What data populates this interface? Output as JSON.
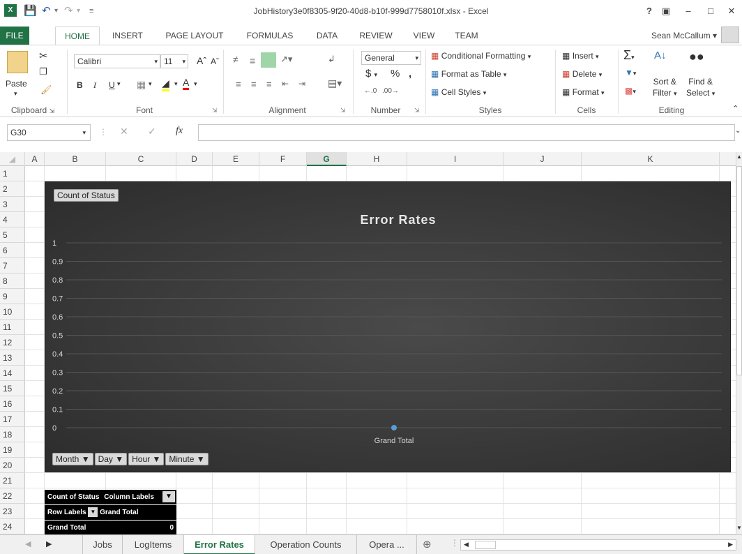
{
  "titlebar": {
    "title": "JobHistory3e0f8305-9f20-40d8-b10f-999d7758010f.xlsx - Excel",
    "help": "?",
    "user": "Sean McCallum"
  },
  "ribbon_tabs": [
    "FILE",
    "HOME",
    "INSERT",
    "PAGE LAYOUT",
    "FORMULAS",
    "DATA",
    "REVIEW",
    "VIEW",
    "TEAM"
  ],
  "clipboard": {
    "paste": "Paste",
    "label": "Clipboard"
  },
  "font": {
    "name": "Calibri",
    "size": "11",
    "label": "Font",
    "bold": "B",
    "italic": "I",
    "underline": "U"
  },
  "alignment": {
    "label": "Alignment"
  },
  "number": {
    "format": "General",
    "currency": "$",
    "percent": "%",
    "comma": ",",
    "label": "Number"
  },
  "styles": {
    "conditional": "Conditional Formatting",
    "table": "Format as Table",
    "cell": "Cell Styles",
    "label": "Styles"
  },
  "cells": {
    "insert": "Insert",
    "delete": "Delete",
    "format": "Format",
    "label": "Cells"
  },
  "editing": {
    "sort_line1": "Sort &",
    "sort_line2": "Filter",
    "find_line1": "Find &",
    "find_line2": "Select",
    "label": "Editing"
  },
  "formula_bar": {
    "name_box": "G30",
    "fx": "fx",
    "value": ""
  },
  "columns": [
    "A",
    "B",
    "C",
    "D",
    "E",
    "F",
    "G",
    "H",
    "I",
    "J",
    "K"
  ],
  "selected_column": "G",
  "rows": [
    "1",
    "2",
    "3",
    "4",
    "5",
    "6",
    "7",
    "8",
    "9",
    "10",
    "11",
    "12",
    "13",
    "14",
    "15",
    "16",
    "17",
    "18",
    "19",
    "20",
    "21",
    "22",
    "23",
    "24"
  ],
  "chart_data": {
    "type": "line",
    "title": "Error Rates",
    "value_field_button": "Count of Status",
    "categories": [
      "Grand Total"
    ],
    "series": [
      {
        "values": [
          0
        ],
        "color": "#5b9bd5"
      }
    ],
    "ylim": [
      0,
      1
    ],
    "yticks": [
      "0",
      "0.1",
      "0.2",
      "0.3",
      "0.4",
      "0.5",
      "0.6",
      "0.7",
      "0.8",
      "0.9",
      "1"
    ],
    "grid": true,
    "axis_field_buttons": [
      "Month",
      "Day",
      "Hour",
      "Minute"
    ]
  },
  "pivot": {
    "row22": [
      "Count of Status",
      "Column Labels"
    ],
    "row23": [
      "Row Labels",
      "Grand Total"
    ],
    "row24": [
      "Grand Total",
      "0"
    ]
  },
  "sheet_tabs": [
    "Jobs",
    "LogItems",
    "Error Rates",
    "Operation Counts",
    "Opera ..."
  ],
  "active_sheet": "Error Rates",
  "colors": {
    "accent": "#217346",
    "series": "#5b9bd5"
  }
}
